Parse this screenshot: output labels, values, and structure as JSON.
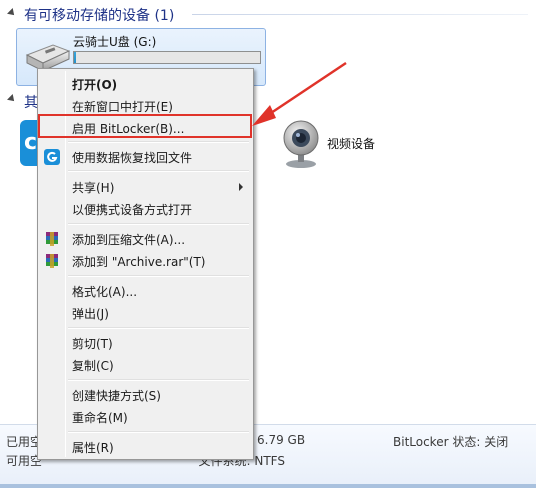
{
  "group_removable": {
    "label": "有可移动存储的设备 (1)"
  },
  "drive": {
    "name": "云骑士U盘 (G:)",
    "used_fraction": 0.01
  },
  "group_other": {
    "label_partial": "其"
  },
  "app_icon_glyph": "c",
  "camera": {
    "label": "视频设备"
  },
  "details": {
    "used_label": "已用空",
    "free_label": "可用空",
    "total_size": "6.79 GB",
    "fs_label": "文件系统: NTFS",
    "bitlocker_status": "BitLocker 状态: 关闭"
  },
  "context_menu": {
    "items": [
      {
        "label": "打开(O)",
        "bold": true,
        "icon": ""
      },
      {
        "label": "在新窗口中打开(E)",
        "icon": ""
      },
      {
        "label": "启用 BitLocker(B)...",
        "icon": ""
      },
      {
        "label": "使用数据恢复找回文件",
        "icon": "recovery-app-icon"
      },
      {
        "label": "共享(H)",
        "icon": "",
        "submenu": true
      },
      {
        "label": "以便携式设备方式打开",
        "icon": ""
      },
      {
        "label": "添加到压缩文件(A)...",
        "icon": "winrar-icon"
      },
      {
        "label": "添加到 \"Archive.rar\"(T)",
        "icon": "winrar-icon"
      },
      {
        "label": "格式化(A)...",
        "icon": ""
      },
      {
        "label": "弹出(J)",
        "icon": ""
      },
      {
        "label": "剪切(T)",
        "icon": ""
      },
      {
        "label": "复制(C)",
        "icon": ""
      },
      {
        "label": "创建快捷方式(S)",
        "icon": ""
      },
      {
        "label": "重命名(M)",
        "icon": ""
      },
      {
        "label": "属性(R)",
        "icon": ""
      }
    ]
  },
  "colors": {
    "highlight_box": "#e0332a",
    "pointer_arrow": "#e0332a",
    "group_header": "#1e3287"
  }
}
